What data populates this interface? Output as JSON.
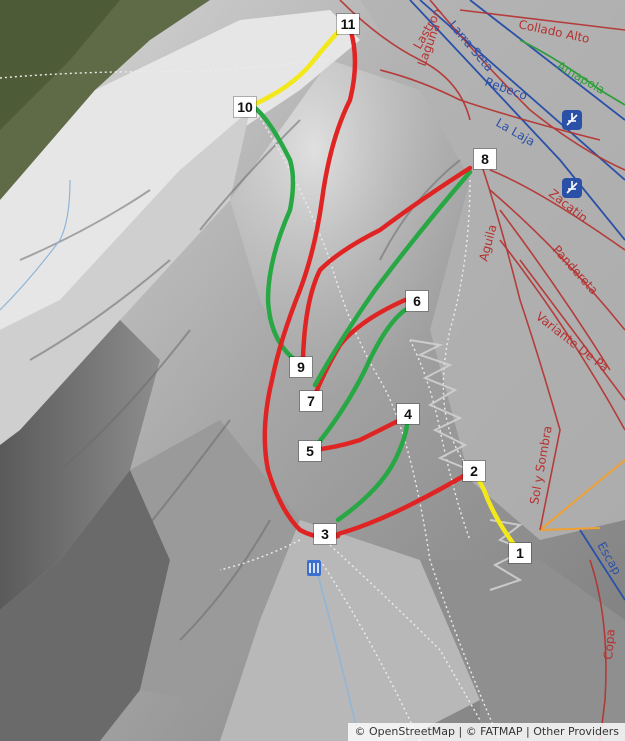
{
  "map": {
    "colors": {
      "red_route": "#e02424",
      "green_route": "#27a844",
      "yellow_route": "#f2e81a",
      "piste_red": "#b5312f",
      "piste_blue": "#2b50a8",
      "piste_green": "#2f9e3a",
      "lift_orange": "#f0a030",
      "track_white": "#e8e8e8"
    },
    "waypoints": [
      {
        "id": "1",
        "label": "1"
      },
      {
        "id": "2",
        "label": "2"
      },
      {
        "id": "3",
        "label": "3"
      },
      {
        "id": "4",
        "label": "4"
      },
      {
        "id": "5",
        "label": "5"
      },
      {
        "id": "6",
        "label": "6"
      },
      {
        "id": "7",
        "label": "7"
      },
      {
        "id": "8",
        "label": "8"
      },
      {
        "id": "9",
        "label": "9"
      },
      {
        "id": "10",
        "label": "10"
      },
      {
        "id": "11",
        "label": "11"
      }
    ],
    "route_segments": [
      {
        "from": "1",
        "to": "2",
        "color": "yellow"
      },
      {
        "from": "2",
        "to": "3",
        "color": "red"
      },
      {
        "from": "3",
        "to": "4",
        "color": "green"
      },
      {
        "from": "4",
        "to": "5",
        "color": "red"
      },
      {
        "from": "5",
        "to": "6",
        "color": "green"
      },
      {
        "from": "6",
        "to": "7",
        "color": "red"
      },
      {
        "from": "7",
        "to": "8",
        "color": "green"
      },
      {
        "from": "8",
        "to": "9",
        "color": "red"
      },
      {
        "from": "9",
        "to": "10",
        "color": "green"
      },
      {
        "from": "10",
        "to": "11",
        "color": "yellow"
      },
      {
        "from": "11",
        "to": "3",
        "color": "red"
      }
    ],
    "piste_labels": {
      "collado_alto": "Collado Alto",
      "amapola": "Amapola",
      "la_laja": "La Laja",
      "zacatin": "Zacatin",
      "pandereta": "Pandereta",
      "variante_de_pa": "Variante De Pa",
      "sol_y_sombra": "Sol y Sombra",
      "aguila": "Aguila",
      "rebeco": "Rebeco",
      "lastron": "Lastron",
      "laguna": "Laguna",
      "escap": "Escap",
      "copa": "Copa",
      "larra_seta": "Larra Seta"
    },
    "icons": [
      "ski-lift-icon",
      "ski-lift-icon",
      "parking-icon"
    ],
    "attribution": {
      "osm": "© OpenStreetMap",
      "sep1": " | ",
      "fatmap": "© FATMAP",
      "sep2": " | ",
      "other": "Other Providers"
    }
  }
}
